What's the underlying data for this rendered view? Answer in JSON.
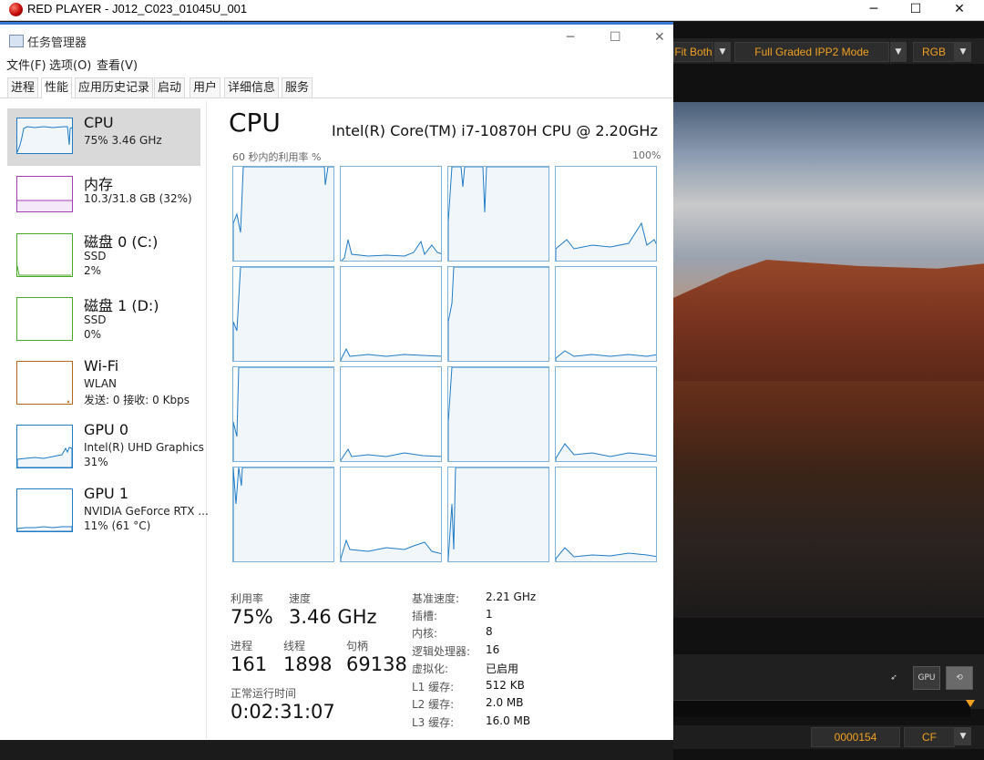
{
  "red_player": {
    "title": "RED PLAYER - J012_C023_01045U_001",
    "toolbar": {
      "fit": "Fit Both",
      "mode": "Full Graded IPP2 Mode",
      "channel": "RGB"
    },
    "timecode": "0000154",
    "cf": "CF",
    "gpu_badge": "GPU"
  },
  "task_manager": {
    "title": "任务管理器",
    "menu": [
      "文件(F)",
      "选项(O)",
      "查看(V)"
    ],
    "tabs": [
      "进程",
      "性能",
      "应用历史记录",
      "启动",
      "用户",
      "详细信息",
      "服务"
    ],
    "sidebar": [
      {
        "name": "CPU",
        "l1": "75%  3.46 GHz",
        "l2": ""
      },
      {
        "name": "内存",
        "l1": "10.3/31.8 GB (32%)",
        "l2": ""
      },
      {
        "name": "磁盘 0 (C:)",
        "l1": "SSD",
        "l2": "2%"
      },
      {
        "name": "磁盘 1 (D:)",
        "l1": "SSD",
        "l2": "0%"
      },
      {
        "name": "Wi-Fi",
        "l1": "WLAN",
        "l2": "发送: 0  接收: 0 Kbps"
      },
      {
        "name": "GPU 0",
        "l1": "Intel(R) UHD Graphics",
        "l2": "31%"
      },
      {
        "name": "GPU 1",
        "l1": "NVIDIA GeForce RTX ...",
        "l2": "11% (61 °C)"
      }
    ],
    "detail": {
      "heading": "CPU",
      "model": "Intel(R) Core(TM) i7-10870H CPU @ 2.20GHz",
      "graph_label": "60 秒内的利用率 %",
      "graph_max": "100%",
      "stats": {
        "util_label": "利用率",
        "util": "75%",
        "speed_label": "速度",
        "speed": "3.46 GHz",
        "proc_label": "进程",
        "proc": "161",
        "thread_label": "线程",
        "thread": "1898",
        "handle_label": "句柄",
        "handle": "69138",
        "uptime_label": "正常运行时间",
        "uptime": "0:02:31:07"
      },
      "kv": [
        {
          "k": "基准速度:",
          "v": "2.21 GHz"
        },
        {
          "k": "插槽:",
          "v": "1"
        },
        {
          "k": "内核:",
          "v": "8"
        },
        {
          "k": "逻辑处理器:",
          "v": "16"
        },
        {
          "k": "虚拟化:",
          "v": "已启用"
        },
        {
          "k": "L1 缓存:",
          "v": "512 KB"
        },
        {
          "k": "L2 缓存:",
          "v": "2.0 MB"
        },
        {
          "k": "L3 缓存:",
          "v": "16.0 MB"
        }
      ]
    }
  },
  "colors": {
    "cpu_line": "#1f7bc4",
    "cpu_fill": "#f1f6fb",
    "mem_line": "#a33fb5",
    "disk_line": "#4aa829",
    "net_line": "#b5651d",
    "tm_accent": "#3a78d6",
    "rp_accent": "#f0a020"
  }
}
